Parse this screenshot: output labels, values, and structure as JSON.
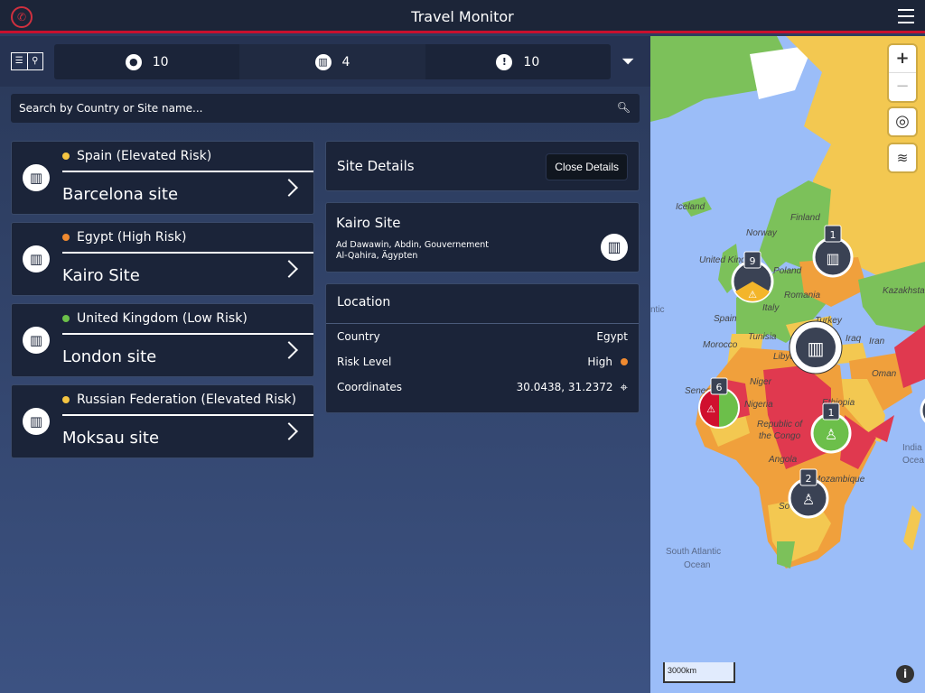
{
  "header": {
    "title": "Travel Monitor",
    "phone_icon": "phone-icon",
    "menu_icon": "hamburger-menu-icon"
  },
  "toolbar": {
    "tabs": [
      {
        "icon": "person-icon",
        "count": "10"
      },
      {
        "icon": "building-icon",
        "count": "4"
      },
      {
        "icon": "warning-icon",
        "count": "10"
      }
    ]
  },
  "search": {
    "placeholder": "Search by Country or Site name..."
  },
  "sites": [
    {
      "risk": "Spain (Elevated Risk)",
      "risk_color": "#f5c542",
      "name": "Barcelona site"
    },
    {
      "risk": "Egypt (High Risk)",
      "risk_color": "#f08a30",
      "name": "Kairo Site"
    },
    {
      "risk": "United Kingdom (Low Risk)",
      "risk_color": "#6cc04a",
      "name": "London site"
    },
    {
      "risk": "Russian Federation (Elevated Risk)",
      "risk_color": "#f5c542",
      "name": "Moksau site"
    }
  ],
  "details": {
    "title": "Site Details",
    "close_label": "Close Details",
    "site_name": "Kairo Site",
    "address_line1": "Ad Dawawin, Abdin, Gouvernement",
    "address_line2": "Al-Qahira, Ägypten",
    "location_title": "Location",
    "rows": [
      {
        "label": "Country",
        "value": "Egypt"
      },
      {
        "label": "Risk Level",
        "value": "High",
        "color": "#f08a30"
      },
      {
        "label": "Coordinates",
        "value": "30.0438, 31.2372"
      }
    ]
  },
  "map": {
    "zoom_in": "+",
    "zoom_out": "−",
    "scale": "3000km",
    "labels": [
      "Iceland",
      "Finland",
      "Norway",
      "United King",
      "Poland",
      "Romania",
      "Kazakhstan",
      "Spain",
      "Italy",
      "Turkey",
      "Tunisia",
      "Morocco",
      "Libya",
      "Iraq",
      "Iran",
      "Oman",
      "Niger",
      "Nigeria",
      "Seneg",
      "Ethiopia",
      "Republic of",
      "the Congo",
      "Angola",
      "Mozambique",
      "So",
      "South Atlantic",
      "Ocean",
      "India",
      "Ocea",
      "ntic"
    ],
    "clusters": [
      {
        "count": "9"
      },
      {
        "count": "1"
      },
      {
        "count": "6"
      },
      {
        "count": "1"
      },
      {
        "count": "2"
      }
    ],
    "risk_colors": {
      "low": "#7cc15a",
      "elevated": "#f3c851",
      "high": "#f0a03c",
      "extreme": "#e0394f"
    }
  }
}
